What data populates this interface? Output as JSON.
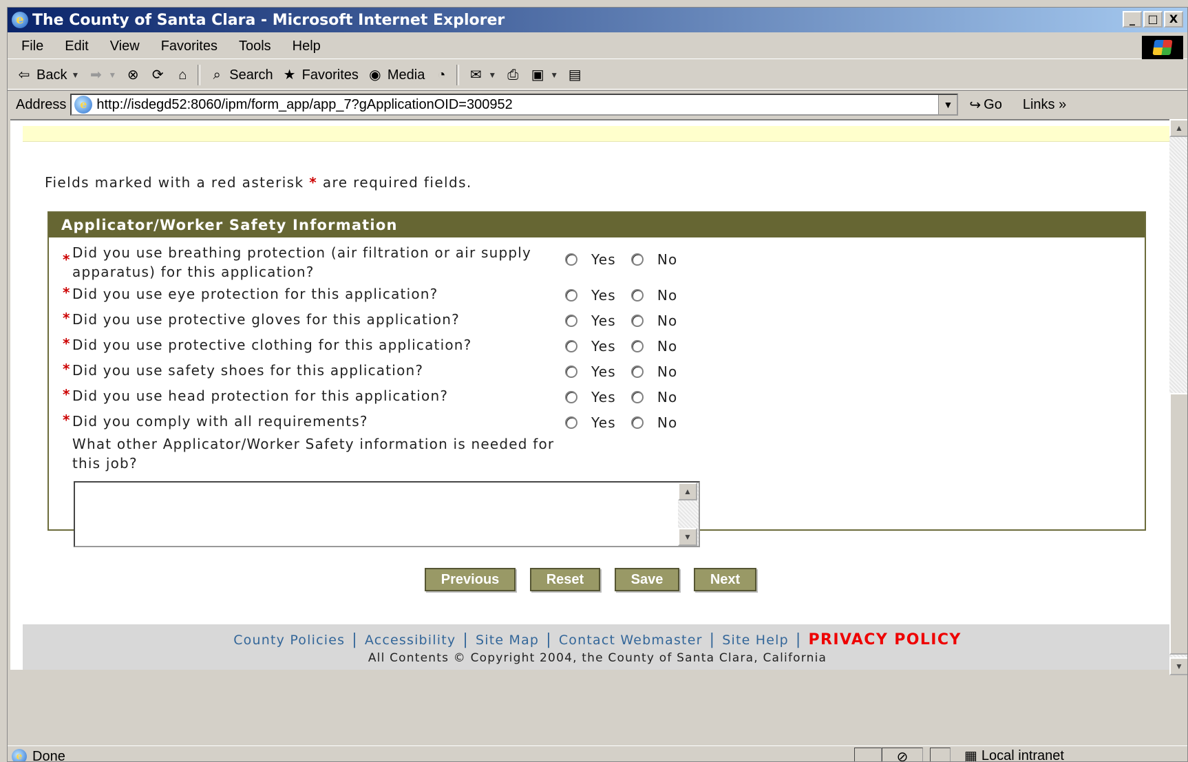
{
  "window": {
    "title": "The County of Santa Clara - Microsoft Internet Explorer",
    "controls": [
      "_",
      "□",
      "X"
    ]
  },
  "menu": [
    "File",
    "Edit",
    "View",
    "Favorites",
    "Tools",
    "Help"
  ],
  "toolbar": {
    "back": "Back",
    "search": "Search",
    "favorites": "Favorites",
    "media": "Media"
  },
  "address": {
    "label": "Address",
    "url": "http://isdegd52:8060/ipm/form_app/app_7?gApplicationOID=300952",
    "go": "Go",
    "links": "Links"
  },
  "form": {
    "required_note_before": "Fields marked with a red asterisk",
    "required_note_star": "*",
    "required_note_after": "are required fields.",
    "section_title": "Applicator/Worker Safety Information",
    "questions": [
      "Did you use breathing protection (air filtration or air supply apparatus) for this application?",
      "Did you use eye protection for this application?",
      "Did you use protective gloves for this application?",
      "Did you use protective clothing for this application?",
      "Did you use safety shoes for this application?",
      "Did you use head protection for this application?",
      "Did you comply with all requirements?"
    ],
    "yes_label": "Yes",
    "no_label": "No",
    "other_question": "What other Applicator/Worker Safety information is needed for this job?",
    "other_value": ""
  },
  "buttons": {
    "previous": "Previous",
    "reset": "Reset",
    "save": "Save",
    "next": "Next"
  },
  "footer": {
    "links": [
      "County Policies",
      "Accessibility",
      "Site Map",
      "Contact Webmaster",
      "Site Help"
    ],
    "privacy": "PRIVACY POLICY",
    "copyright": "All Contents © Copyright 2004, the County of Santa Clara, California"
  },
  "status": {
    "text": "Done",
    "zone": "Local intranet"
  },
  "colors": {
    "section_header": "#666633",
    "button": "#999966",
    "required": "#cc0000",
    "link": "#336699",
    "privacy": "#ee0000"
  }
}
